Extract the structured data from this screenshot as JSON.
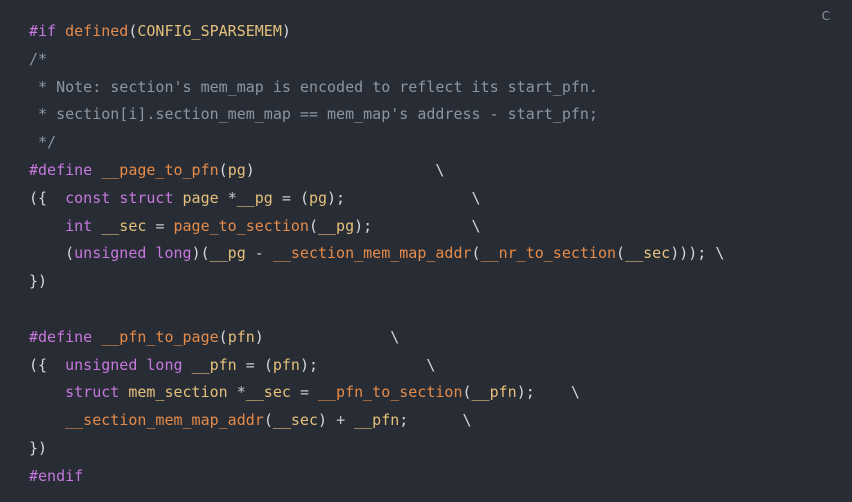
{
  "copy_label": "C",
  "code_lines": [
    [
      {
        "t": "#if ",
        "c": "keyword"
      },
      {
        "t": "defined",
        "c": "fn"
      },
      {
        "t": "(",
        "c": "punc"
      },
      {
        "t": "CONFIG_SPARSEMEM",
        "c": "ident"
      },
      {
        "t": ")",
        "c": "punc"
      }
    ],
    [
      {
        "t": "/*",
        "c": "comment"
      }
    ],
    [
      {
        "t": " * Note: section's mem_map is encoded to reflect its start_pfn.",
        "c": "comment"
      }
    ],
    [
      {
        "t": " * section[i].section_mem_map == mem_map's address - start_pfn;",
        "c": "comment"
      }
    ],
    [
      {
        "t": " */",
        "c": "comment"
      }
    ],
    [
      {
        "t": "#define ",
        "c": "keyword"
      },
      {
        "t": "__page_to_pfn",
        "c": "fn"
      },
      {
        "t": "(",
        "c": "punc"
      },
      {
        "t": "pg",
        "c": "ident"
      },
      {
        "t": ")",
        "c": "punc"
      },
      {
        "t": "                    \\",
        "c": "punc"
      }
    ],
    [
      {
        "t": "({  ",
        "c": "punc"
      },
      {
        "t": "const ",
        "c": "keyword"
      },
      {
        "t": "struct ",
        "c": "keyword"
      },
      {
        "t": "page ",
        "c": "ident"
      },
      {
        "t": "*",
        "c": "op"
      },
      {
        "t": "__pg ",
        "c": "ident"
      },
      {
        "t": "= ",
        "c": "op"
      },
      {
        "t": "(",
        "c": "punc"
      },
      {
        "t": "pg",
        "c": "ident"
      },
      {
        "t": ");",
        "c": "punc"
      },
      {
        "t": "              \\",
        "c": "punc"
      }
    ],
    [
      {
        "t": "    ",
        "c": "punc"
      },
      {
        "t": "int ",
        "c": "keyword"
      },
      {
        "t": "__sec ",
        "c": "ident"
      },
      {
        "t": "= ",
        "c": "op"
      },
      {
        "t": "page_to_section",
        "c": "fn"
      },
      {
        "t": "(",
        "c": "punc"
      },
      {
        "t": "__pg",
        "c": "ident"
      },
      {
        "t": ");",
        "c": "punc"
      },
      {
        "t": "           \\",
        "c": "punc"
      }
    ],
    [
      {
        "t": "    (",
        "c": "punc"
      },
      {
        "t": "unsigned ",
        "c": "keyword"
      },
      {
        "t": "long",
        "c": "keyword"
      },
      {
        "t": ")(",
        "c": "punc"
      },
      {
        "t": "__pg ",
        "c": "ident"
      },
      {
        "t": "- ",
        "c": "op"
      },
      {
        "t": "__section_mem_map_addr",
        "c": "fn"
      },
      {
        "t": "(",
        "c": "punc"
      },
      {
        "t": "__nr_to_section",
        "c": "fn"
      },
      {
        "t": "(",
        "c": "punc"
      },
      {
        "t": "__sec",
        "c": "ident"
      },
      {
        "t": "))); \\",
        "c": "punc"
      }
    ],
    [
      {
        "t": "})",
        "c": "punc"
      }
    ],
    [
      {
        "t": "",
        "c": "punc"
      }
    ],
    [
      {
        "t": "#define ",
        "c": "keyword"
      },
      {
        "t": "__pfn_to_page",
        "c": "fn"
      },
      {
        "t": "(",
        "c": "punc"
      },
      {
        "t": "pfn",
        "c": "ident"
      },
      {
        "t": ")",
        "c": "punc"
      },
      {
        "t": "              \\",
        "c": "punc"
      }
    ],
    [
      {
        "t": "({  ",
        "c": "punc"
      },
      {
        "t": "unsigned ",
        "c": "keyword"
      },
      {
        "t": "long ",
        "c": "keyword"
      },
      {
        "t": "__pfn ",
        "c": "ident"
      },
      {
        "t": "= ",
        "c": "op"
      },
      {
        "t": "(",
        "c": "punc"
      },
      {
        "t": "pfn",
        "c": "ident"
      },
      {
        "t": ");",
        "c": "punc"
      },
      {
        "t": "            \\",
        "c": "punc"
      }
    ],
    [
      {
        "t": "    ",
        "c": "punc"
      },
      {
        "t": "struct ",
        "c": "keyword"
      },
      {
        "t": "mem_section ",
        "c": "ident"
      },
      {
        "t": "*",
        "c": "op"
      },
      {
        "t": "__sec ",
        "c": "ident"
      },
      {
        "t": "= ",
        "c": "op"
      },
      {
        "t": "__pfn_to_section",
        "c": "fn"
      },
      {
        "t": "(",
        "c": "punc"
      },
      {
        "t": "__pfn",
        "c": "ident"
      },
      {
        "t": ");",
        "c": "punc"
      },
      {
        "t": "    \\",
        "c": "punc"
      }
    ],
    [
      {
        "t": "    ",
        "c": "punc"
      },
      {
        "t": "__section_mem_map_addr",
        "c": "fn"
      },
      {
        "t": "(",
        "c": "punc"
      },
      {
        "t": "__sec",
        "c": "ident"
      },
      {
        "t": ") ",
        "c": "punc"
      },
      {
        "t": "+ ",
        "c": "op"
      },
      {
        "t": "__pfn",
        "c": "ident"
      },
      {
        "t": ";",
        "c": "punc"
      },
      {
        "t": "      \\",
        "c": "punc"
      }
    ],
    [
      {
        "t": "})",
        "c": "punc"
      }
    ],
    [
      {
        "t": "#endif",
        "c": "keyword"
      }
    ]
  ]
}
